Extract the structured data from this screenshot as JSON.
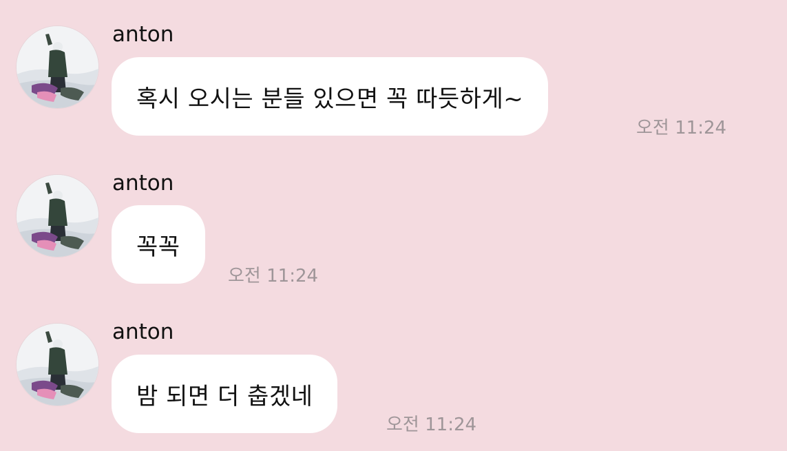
{
  "chat": {
    "messages": [
      {
        "sender": "anton",
        "avatar_icon": "profile-photo-snowboarder",
        "text": "혹시 오시는 분들 있으면 꼭 따듯하게~",
        "time": "오전 11:24"
      },
      {
        "sender": "anton",
        "avatar_icon": "profile-photo-snowboarder",
        "text": "꼭꼭",
        "time": "오전 11:24"
      },
      {
        "sender": "anton",
        "avatar_icon": "profile-photo-snowboarder",
        "text": "밤 되면 더 춥겠네",
        "time": "오전 11:24"
      }
    ]
  },
  "colors": {
    "background": "#f4dbe0",
    "bubble": "#ffffff",
    "timestamp": "#9e9598"
  }
}
